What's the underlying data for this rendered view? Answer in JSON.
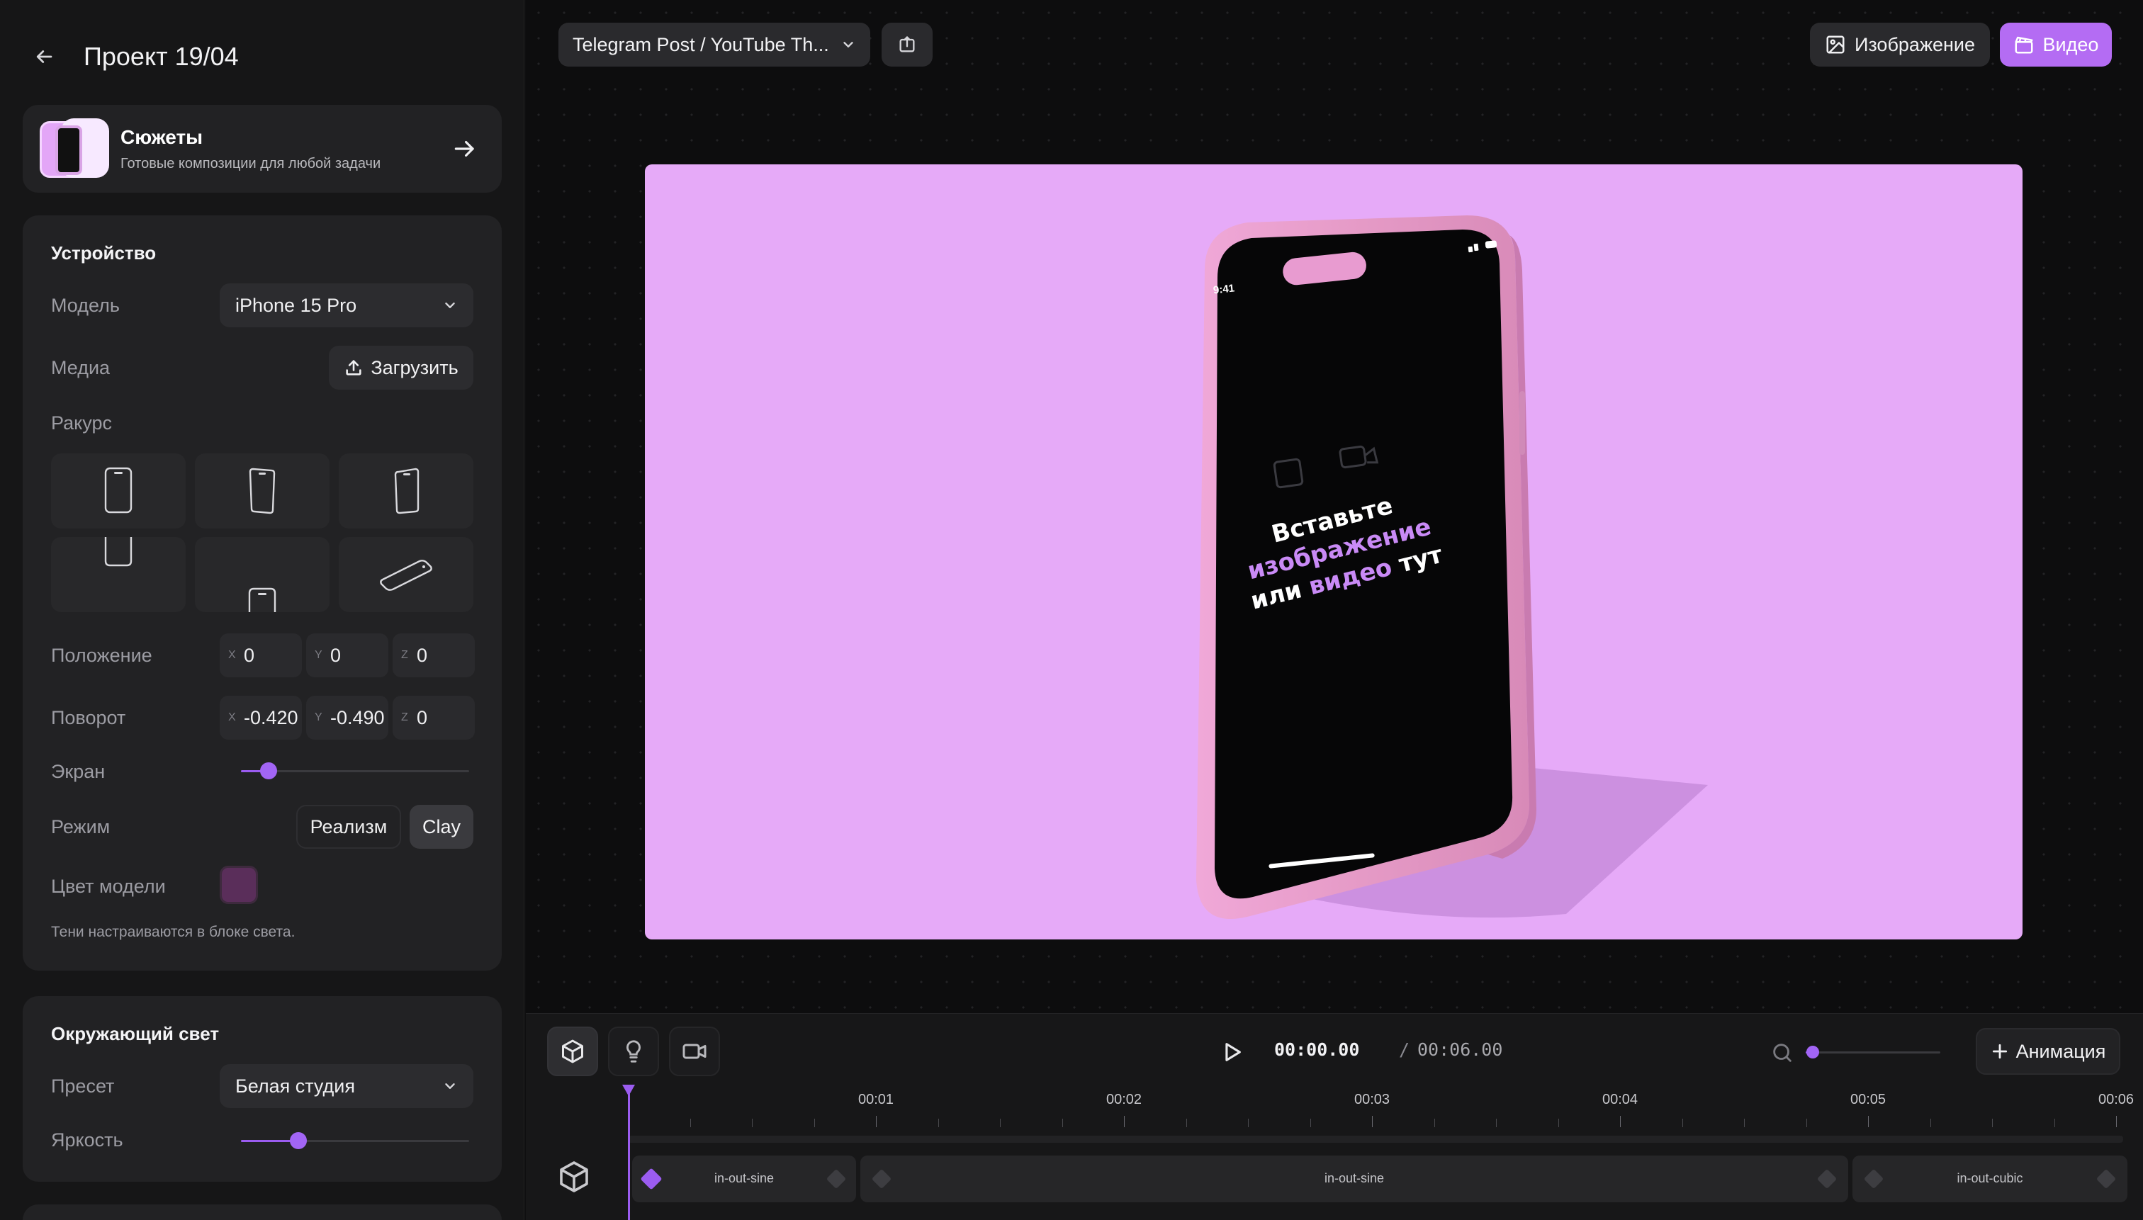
{
  "sidebar": {
    "project_title": "Проект 19/04",
    "scenes": {
      "title": "Сюжеты",
      "subtitle": "Готовые композиции для любой задачи"
    },
    "device": {
      "section_title": "Устройство",
      "model_label": "Модель",
      "model_value": "iPhone 15 Pro",
      "media_label": "Медиа",
      "upload_label": "Загрузить",
      "angle_label": "Ракурс",
      "position_label": "Положение",
      "position": {
        "x": "0",
        "y": "0",
        "z": "0"
      },
      "rotation_label": "Поворот",
      "rotation": {
        "x": "-0.420",
        "y": "-0.490",
        "z": "0"
      },
      "axis_labels": {
        "x": "X",
        "y": "Y",
        "z": "Z"
      },
      "screen_label": "Экран",
      "screen_level": 0.12,
      "mode_label": "Режим",
      "mode_realism": "Реализм",
      "mode_clay": "Clay",
      "color_label": "Цвет модели",
      "color_value": "#5a2e5a",
      "hint": "Тени настраиваются в блоке света."
    },
    "light": {
      "section_title": "Окружающий свет",
      "preset_label": "Пресет",
      "preset_value": "Белая студия",
      "brightness_label": "Яркость",
      "brightness_level": 0.25
    }
  },
  "topbar": {
    "format_select": "Telegram Post / YouTube Th...",
    "image_button": "Изображение",
    "video_button": "Видео"
  },
  "canvas": {
    "background": "#e6aaf8",
    "phone_time": "9:41",
    "placeholder_line1": "Вставьте",
    "placeholder_line2": "изображение",
    "placeholder_line3a": "или",
    "placeholder_line3b": "видео",
    "placeholder_line3c": "тут"
  },
  "timeline": {
    "current_time": "00:00.00",
    "separator": "/",
    "total_time": "00:06.00",
    "add_animation": "Анимация",
    "zoom_level": 0.05,
    "ruler_labels": [
      "00:01",
      "00:02",
      "00:03",
      "00:04",
      "00:05",
      "00:06"
    ],
    "segments": [
      {
        "label": "in-out-sine"
      },
      {
        "label": "in-out-sine"
      },
      {
        "label": "in-out-cubic"
      }
    ]
  },
  "colors": {
    "accent": "#9b5cf0",
    "video_button": "#b46cf3"
  }
}
